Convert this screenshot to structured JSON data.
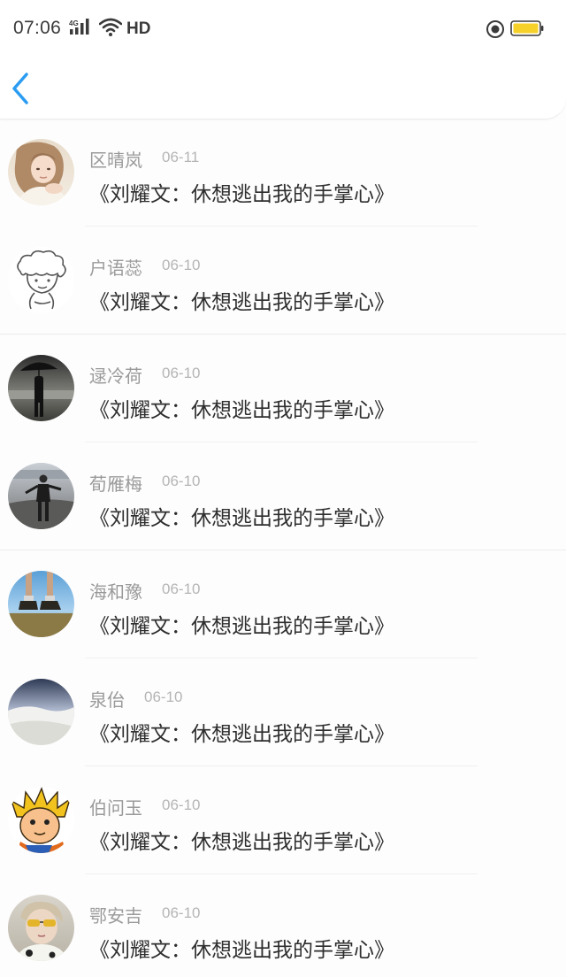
{
  "status_bar": {
    "time": "07:06",
    "network_label": "4G",
    "hd_label": "HD",
    "battery_color": "#f5d12a"
  },
  "header": {
    "back_icon": "chevron-left-icon",
    "accent_color": "#2b9cf2"
  },
  "comments": [
    {
      "name": "区晴岚",
      "date": "06-11",
      "title": "《刘耀文：休想逃出我的手掌心》",
      "avatar": "portrait-girl"
    },
    {
      "name": "户语蕊",
      "date": "06-10",
      "title": "《刘耀文：休想逃出我的手掌心》",
      "avatar": "sketch-cartoon"
    },
    {
      "name": "逯冷荷",
      "date": "06-10",
      "title": "《刘耀文：休想逃出我的手掌心》",
      "avatar": "umbrella-figure"
    },
    {
      "name": "荀雁梅",
      "date": "06-10",
      "title": "《刘耀文：休想逃出我的手掌心》",
      "avatar": "person-dark"
    },
    {
      "name": "海和豫",
      "date": "06-10",
      "title": "《刘耀文：休想逃出我的手掌心》",
      "avatar": "feet-sky"
    },
    {
      "name": "泉佁",
      "date": "06-10",
      "title": "《刘耀文：休想逃出我的手掌心》",
      "avatar": "snow-landscape"
    },
    {
      "name": "伯问玉",
      "date": "06-10",
      "title": "《刘耀文：休想逃出我的手掌心》",
      "avatar": "cartoon-goku"
    },
    {
      "name": "鄂安吉",
      "date": "06-10",
      "title": "《刘耀文：休想逃出我的手掌心》",
      "avatar": "sunglasses-portrait"
    }
  ]
}
